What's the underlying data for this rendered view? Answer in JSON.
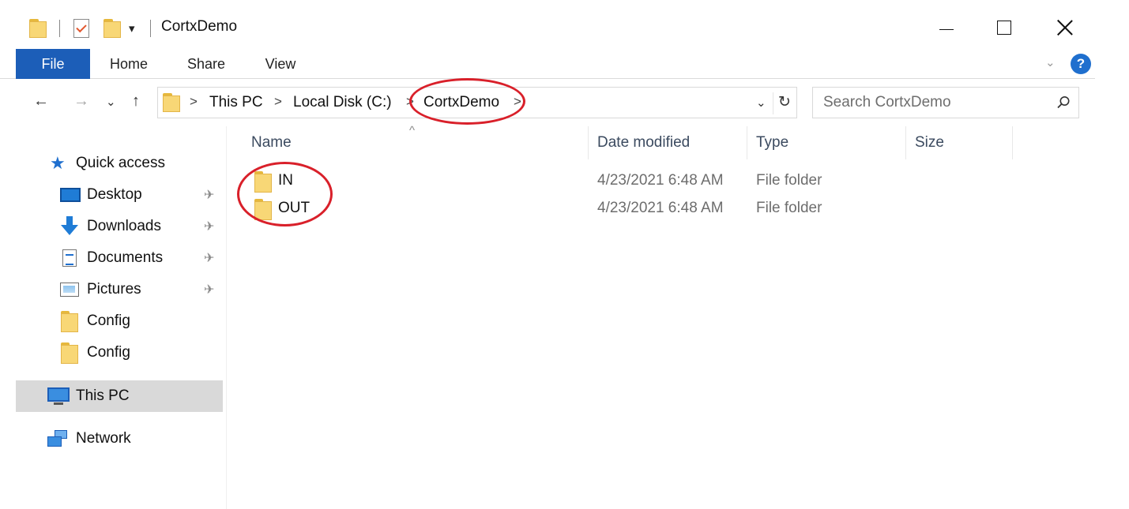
{
  "window": {
    "title": "CortxDemo",
    "qa_dropdown_glyph": "▾",
    "controls": [
      "minimize-icon",
      "maximize-icon",
      "close-icon"
    ]
  },
  "ribbon": {
    "tabs": [
      {
        "label": "File",
        "active": true
      },
      {
        "label": "Home"
      },
      {
        "label": "Share"
      },
      {
        "label": "View"
      }
    ],
    "collapse_glyph": "⌄",
    "help_label": "?"
  },
  "nav": {
    "back_glyph": "←",
    "forward_glyph": "→",
    "recent_glyph": "⌄",
    "up_glyph": "↑",
    "breadcrumb": [
      "This PC",
      "Local Disk (C:)",
      "CortxDemo"
    ],
    "breadcrumb_sep": ">",
    "dropdown_glyph": "⌄",
    "refresh_glyph": "↻"
  },
  "search": {
    "placeholder": "Search CortxDemo"
  },
  "sidebar": {
    "items": [
      {
        "label": "Quick access",
        "icon": "star-icon"
      },
      {
        "label": "Desktop",
        "icon": "desktop-icon",
        "pinned": true
      },
      {
        "label": "Downloads",
        "icon": "download-icon",
        "pinned": true
      },
      {
        "label": "Documents",
        "icon": "documents-icon",
        "pinned": true
      },
      {
        "label": "Pictures",
        "icon": "pictures-icon",
        "pinned": true
      },
      {
        "label": "Config",
        "icon": "folder-icon"
      },
      {
        "label": "Config",
        "icon": "folder-icon"
      },
      {
        "label": "This PC",
        "icon": "computer-icon",
        "selected": true
      },
      {
        "label": "Network",
        "icon": "network-icon"
      }
    ],
    "pin_glyph": "📌"
  },
  "file_list": {
    "sort_glyph": "^",
    "columns": [
      "Name",
      "Date modified",
      "Type",
      "Size"
    ],
    "rows": [
      {
        "name": "IN",
        "date": "4/23/2021 6:48 AM",
        "type": "File folder",
        "size": ""
      },
      {
        "name": "OUT",
        "date": "4/23/2021 6:48 AM",
        "type": "File folder",
        "size": ""
      }
    ]
  },
  "colors": {
    "file_tab": "#1c5eb8",
    "annotation": "#d9202a",
    "selected_bg": "#d9d9d9",
    "folder": "#f8d776"
  }
}
